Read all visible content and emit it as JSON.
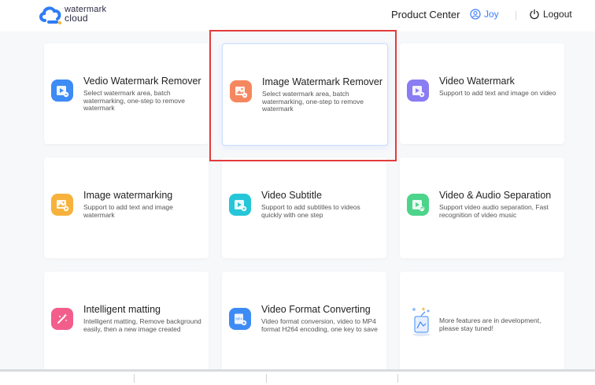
{
  "header": {
    "logo_line1": "watermark",
    "logo_line2": "cloud",
    "product_center": "Product Center",
    "user_name": "Joy",
    "logout": "Logout"
  },
  "colors": {
    "accent": "#3b7cff",
    "selection": "#e33b3b"
  },
  "cards": [
    {
      "title": "Vedio Watermark Remover",
      "desc": "Select watermark area, batch watermarking, one-step to remove watermark",
      "icon": "video-remove-icon",
      "color": "#3d8bf5"
    },
    {
      "title": "Image Watermark Remover",
      "desc": "Select watermark area, batch watermarking, one-step to remove watermark",
      "icon": "image-remove-icon",
      "color": "#f5875f"
    },
    {
      "title": "Video Watermark",
      "desc": "Support to add text and image on video",
      "icon": "video-watermark-icon",
      "color": "#8a7cf2"
    },
    {
      "title": "Image watermarking",
      "desc": "Support to add text and image watermark",
      "icon": "image-watermark-icon",
      "color": "#f7b23c"
    },
    {
      "title": "Video Subtitle",
      "desc": "Support to add subtitles to videos quickly with one step",
      "icon": "video-subtitle-icon",
      "color": "#26c6d9"
    },
    {
      "title": "Video & Audio Separation",
      "desc": "Support video audio separation, Fast recognition of video music",
      "icon": "audio-separation-icon",
      "color": "#4cd48a"
    },
    {
      "title": "Intelligent matting",
      "desc": "Intelligent matting, Remove background easily, then a new image created",
      "icon": "magic-wand-icon",
      "color": "#f35d8c"
    },
    {
      "title": "Video Format Converting",
      "desc": "Video format conversion, video to MP4 format H264 encoding, one key to save",
      "icon": "mp4-convert-icon",
      "color": "#3d8bf5"
    }
  ],
  "more_features": "More features are in development, please stay tuned!"
}
